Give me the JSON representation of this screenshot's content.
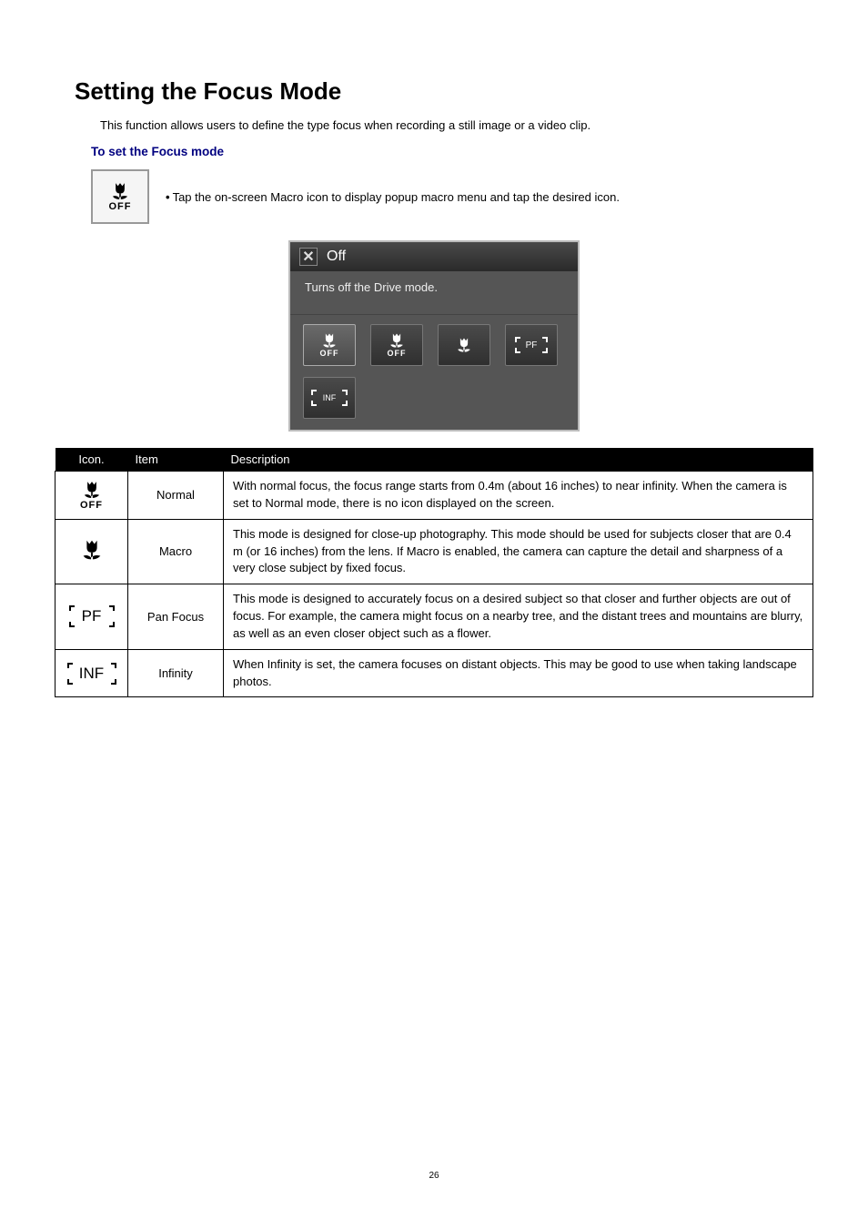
{
  "page_title": "Setting the Focus Mode",
  "intro": "This function allows users to define the type focus when recording a still image or a video clip.",
  "subheading": "To set the Focus mode",
  "tap_instruction": "Tap the on-screen Macro icon to display popup macro menu and tap the desired icon.",
  "popup": {
    "title": "Off",
    "description": "Turns off the Drive mode.",
    "close_glyph": "✕",
    "pf_label_small": "PF",
    "inf_label_small": "INF",
    "off_label": "OFF"
  },
  "table": {
    "headers": {
      "icon": "Icon.",
      "item": "Item",
      "desc": "Description"
    },
    "rows": [
      {
        "icon_key": "normal",
        "off_label": "OFF",
        "item": "Normal",
        "desc": "With normal focus, the focus range starts from 0.4m (about 16 inches) to near infinity. When the camera is set to Normal mode, there is no icon displayed on the screen."
      },
      {
        "icon_key": "macro",
        "item": "Macro",
        "desc": "This mode is designed for close-up photography.  This mode should be used for subjects closer that are 0.4 m (or 16 inches) from the lens.  If Macro is enabled, the camera can capture the detail and sharpness of a very close subject by fixed focus."
      },
      {
        "icon_key": "pf",
        "pf_label": "PF",
        "item": "Pan Focus",
        "desc": "This mode is designed to accurately focus on a desired subject so that closer and further objects are out of focus. For example, the camera might focus on a nearby tree, and the distant trees and mountains are blurry, as well as an even closer object such as a flower."
      },
      {
        "icon_key": "inf",
        "inf_label": "INF",
        "item": "Infinity",
        "desc": "When Infinity is set, the camera focuses on distant objects. This may be good to use when taking landscape photos."
      }
    ]
  },
  "page_number": "26"
}
